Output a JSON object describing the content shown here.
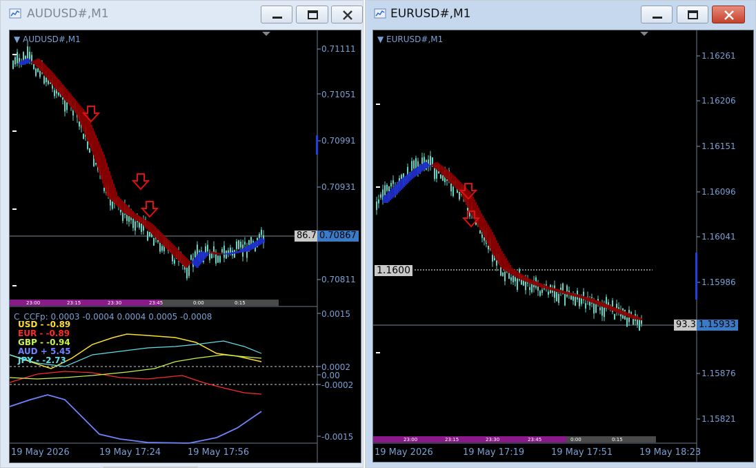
{
  "left_window": {
    "title": "AUDUSD#,M1",
    "symbol_label": "AUDUSD#,M1",
    "price_ticks": [
      "0.71111",
      "0.71051",
      "0.70991",
      "0.70931",
      "0.70811"
    ],
    "current_price": "0.70867",
    "indicator_value": "86.7",
    "time_labels": [
      "23:00",
      "23:15",
      "23:30",
      "23:45",
      "0:00",
      "0:15"
    ],
    "indicator": {
      "title": "C_CCFp: 0.0003 -0.0004 0.0004 0.0005 -0.0008",
      "currencies": [
        {
          "label": "USD -  -0.89",
          "color": "#ffdf2e"
        },
        {
          "label": "EUR -  -0.89",
          "color": "#ff2a2a"
        },
        {
          "label": "GBP -  -0.94",
          "color": "#c9f54a"
        },
        {
          "label": "AUD +  5.45",
          "color": "#6f83ff"
        },
        {
          "label": "JPY -  -2.73",
          "color": "#5fe0e8"
        }
      ],
      "scale_ticks": [
        "0.0015",
        "0.0002",
        "0.00",
        "-0.0002",
        "-0.0015"
      ]
    },
    "date_labels": [
      "19 May 2026",
      "19 May 17:24",
      "19 May 17:56"
    ]
  },
  "right_window": {
    "title": "EURUSD#,M1",
    "symbol_label": "EURUSD#,M1",
    "price_ticks": [
      "1.16261",
      "1.16206",
      "1.16151",
      "1.16096",
      "1.16041",
      "1.15986",
      "1.15876",
      "1.15821"
    ],
    "current_price": "1.15933",
    "indicator_value": "93.3",
    "level_label": "1.1600",
    "time_labels": [
      "23:00",
      "23:15",
      "23:30",
      "23:45",
      "0:00",
      "0:15"
    ],
    "date_labels": [
      "19 May 2026",
      "19 May 17:19",
      "19 May 17:51",
      "19 May 18:23"
    ]
  },
  "colors": {
    "chart_bg": "#000000",
    "candle": "#5fd3c4",
    "arrow": "#e01010",
    "ribbon_red": "#8b0000",
    "ribbon_blue": "#1e2cc8",
    "axis_text": "#7aa0d4",
    "timebar_purple": "#8a1a8a"
  },
  "icons": {
    "title_icon": "chart-window-icon",
    "minimize": "minimize-icon",
    "maximize": "maximize-icon",
    "close": "close-icon"
  }
}
